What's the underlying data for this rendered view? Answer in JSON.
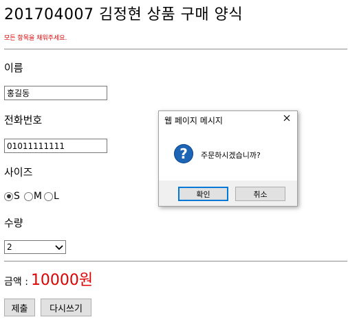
{
  "page": {
    "title": "201704007 김정현 상품 구매 양식",
    "notice": "모든 항목을 채워주세요."
  },
  "form": {
    "name_label": "이름",
    "name_value": "홍길동",
    "phone_label": "전화번호",
    "phone_value": "01011111111",
    "size_label": "사이즈",
    "size_options": [
      "S",
      "M",
      "L"
    ],
    "size_selected": "S",
    "qty_label": "수량",
    "qty_value": "2",
    "amount_label": "금액 :",
    "amount_value": "10000원",
    "submit_label": "제출",
    "reset_label": "다시쓰기"
  },
  "dialog": {
    "title": "웹 페이지 메시지",
    "message": "주문하시겠습니까?",
    "ok_label": "확인",
    "cancel_label": "취소",
    "icon": "question-icon",
    "icon_color": "#1e64b4"
  },
  "colors": {
    "notice": "#e00000",
    "amount": "#e00000"
  }
}
